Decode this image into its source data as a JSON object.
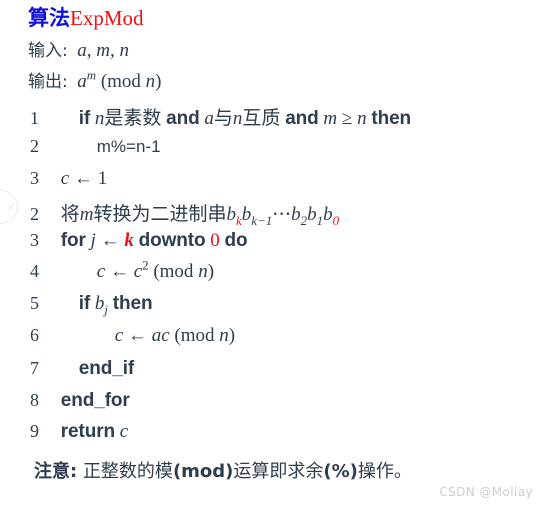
{
  "title": {
    "cjk": "算法",
    "name": "ExpMod",
    "cjk_color": "#1111dd",
    "name_color": "#ee1111"
  },
  "io": {
    "input_label": "输入:",
    "input_value": "a, m, n",
    "output_label": "输出:",
    "output_value": "aᵐ (mod n)"
  },
  "colors": {
    "text": "#2f3e4e",
    "highlight": "#ee1111",
    "background": "#ffffff",
    "watermark": "#cdcdcd"
  },
  "code": [
    {
      "no": "1",
      "indent": 1,
      "text": "if n是素数 and a与n互质 and m ≥ n then",
      "parts": [
        {
          "t": "if",
          "style": "kw"
        },
        {
          "t": "n",
          "style": "mathit"
        },
        {
          "t": "是素数",
          "style": "cjk"
        },
        {
          "t": "and",
          "style": "kw"
        },
        {
          "t": "a",
          "style": "mathit"
        },
        {
          "t": "与",
          "style": "cjk"
        },
        {
          "t": "n",
          "style": "mathit"
        },
        {
          "t": "互质",
          "style": "cjk"
        },
        {
          "t": "and",
          "style": "kw"
        },
        {
          "t": "m",
          "style": "mathit"
        },
        {
          "t": "≥",
          "style": "op"
        },
        {
          "t": "n",
          "style": "mathit"
        },
        {
          "t": "then",
          "style": "kw"
        }
      ]
    },
    {
      "no": "2",
      "indent": 2,
      "text": "m%=n-1",
      "parts": [
        {
          "t": "m%=n-1",
          "style": "sans"
        }
      ]
    },
    {
      "no": "3",
      "indent": 0,
      "text": "c ← 1",
      "parts": [
        {
          "t": "c",
          "style": "mathit"
        },
        {
          "t": "←",
          "style": "op"
        },
        {
          "t": "1",
          "style": "mathrm"
        }
      ]
    },
    {
      "no": "2",
      "indent": 0,
      "text": "将m转换为二进制串bk bk−1 ⋯ b2 b1 b0",
      "parts": [
        {
          "t": "将",
          "style": "cjk"
        },
        {
          "t": "m",
          "style": "mathit"
        },
        {
          "t": "转换为二进制串",
          "style": "cjk"
        },
        {
          "t": "b_k b_{k-1} ⋯ b_2 b_1 b_0",
          "style": "mathit"
        }
      ]
    },
    {
      "no": "3",
      "indent": 0,
      "text": "for j ← k downto 0 do",
      "parts": [
        {
          "t": "for",
          "style": "kw"
        },
        {
          "t": "j",
          "style": "mathit"
        },
        {
          "t": "←",
          "style": "op"
        },
        {
          "t": "k",
          "style": "mathit-red"
        },
        {
          "t": "downto",
          "style": "kw"
        },
        {
          "t": "0",
          "style": "mathrm-red"
        },
        {
          "t": "do",
          "style": "kw"
        }
      ]
    },
    {
      "no": "4",
      "indent": 1,
      "text": "c ← c² (mod n)",
      "parts": [
        {
          "t": "c",
          "style": "mathit"
        },
        {
          "t": "←",
          "style": "op"
        },
        {
          "t": "c²",
          "style": "mathit"
        },
        {
          "t": "(mod n)",
          "style": "mathrm"
        }
      ]
    },
    {
      "no": "5",
      "indent": 1,
      "text": "if bj then",
      "parts": [
        {
          "t": "if",
          "style": "kw"
        },
        {
          "t": "b_j",
          "style": "mathit"
        },
        {
          "t": "then",
          "style": "kw"
        }
      ]
    },
    {
      "no": "6",
      "indent": 2,
      "text": "c ← ac (mod n)",
      "parts": [
        {
          "t": "c",
          "style": "mathit"
        },
        {
          "t": "←",
          "style": "op"
        },
        {
          "t": "ac",
          "style": "mathit"
        },
        {
          "t": "(mod n)",
          "style": "mathrm"
        }
      ]
    },
    {
      "no": "7",
      "indent": 1,
      "text": "end_if",
      "parts": [
        {
          "t": "end_if",
          "style": "kw"
        }
      ]
    },
    {
      "no": "8",
      "indent": 0,
      "text": "end_for",
      "parts": [
        {
          "t": "end_for",
          "style": "kw"
        }
      ]
    },
    {
      "no": "9",
      "indent": 0,
      "text": "return c",
      "parts": [
        {
          "t": "return",
          "style": "kw"
        },
        {
          "t": "c",
          "style": "mathit"
        }
      ]
    }
  ],
  "code_numbers": {
    "l1": "1",
    "l2": "2",
    "l3": "3",
    "l4": "2",
    "l5": "3",
    "l6": "4",
    "l7": "5",
    "l8": "6",
    "l9": "7",
    "l10": "8",
    "l11": "9"
  },
  "code_text": {
    "l2_body": "m%=n-1",
    "l11_kw": "return",
    "l10_kw": "end_for",
    "l9_kw": "end_if",
    "kw_if": "if",
    "kw_and": "and",
    "kw_then": "then",
    "kw_for": "for",
    "kw_downto": "downto",
    "kw_do": "do",
    "cjk_prime": "是素数",
    "cjk_with": "与",
    "cjk_coprime": "互质",
    "cjk_convert_pre": "将",
    "cjk_convert_post": "转换为二进制串",
    "mod_text": "(mod",
    "paren_close": ")",
    "ge": "≥",
    "assign": "←",
    "dots": "⋯",
    "one": "1",
    "zero": "0"
  },
  "note": {
    "label": "注意:",
    "body_pre": " 正整数的模",
    "body_mod": "(mod)",
    "body_mid": "运算即求余",
    "body_pct": "(%)",
    "body_post": "操作。"
  },
  "watermark": {
    "text": "CSDN @Moliay"
  },
  "artifact": {
    "text": "×"
  }
}
